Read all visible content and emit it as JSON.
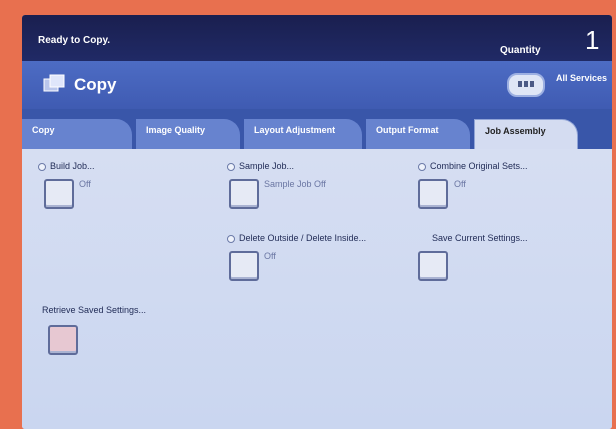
{
  "status": {
    "text": "Ready to Copy."
  },
  "quantity": {
    "label": "Quantity",
    "value": "1"
  },
  "header": {
    "title": "Copy",
    "all_services_label": "All Services"
  },
  "tabs": [
    {
      "label": "Copy"
    },
    {
      "label": "Image Quality"
    },
    {
      "label": "Layout Adjustment"
    },
    {
      "label": "Output Format"
    },
    {
      "label": "Job Assembly",
      "active": true
    }
  ],
  "options": {
    "build_job": {
      "label": "Build Job...",
      "value": "Off"
    },
    "sample_job": {
      "label": "Sample Job...",
      "value": "Sample Job Off"
    },
    "combine_original_sets": {
      "label": "Combine Original Sets...",
      "value": "Off"
    },
    "delete_outside_inside": {
      "label": "Delete Outside / Delete Inside...",
      "value": "Off"
    },
    "save_current_settings": {
      "label": "Save Current Settings..."
    },
    "retrieve_saved_settings": {
      "label": "Retrieve Saved Settings..."
    }
  },
  "icons": [
    "copy-icon",
    "all-services-icon",
    "radio-icon"
  ],
  "colors": {
    "topbar": "#1a1f4f",
    "header": "#4d6cc4",
    "tab_active": "#d4dcf1",
    "content_bg": "#d6def2"
  }
}
